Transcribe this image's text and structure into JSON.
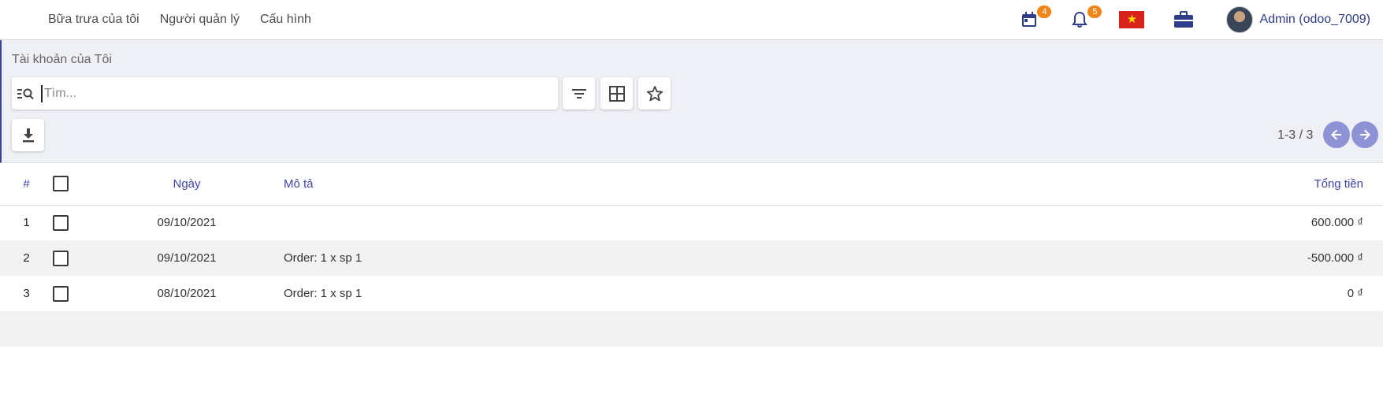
{
  "navbar": {
    "menu": [
      "Bữa trưa của tôi",
      "Người quản lý",
      "Cấu hình"
    ],
    "calendar_badge": "4",
    "notifications_badge": "5",
    "flag_icon": "vietnam-flag-icon",
    "user_name": "Admin (odoo_7009)"
  },
  "control_panel": {
    "breadcrumb": "Tài khoản của Tôi",
    "search_placeholder": "Tìm...",
    "buttons": [
      "filter-icon",
      "grid-icon",
      "star-icon",
      "download-icon"
    ],
    "pager": "1-3 / 3"
  },
  "table": {
    "headers": {
      "num": "#",
      "date": "Ngày",
      "description": "Mô tả",
      "total": "Tổng tiền"
    },
    "rows": [
      {
        "num": "1",
        "date": "09/10/2021",
        "description": "",
        "total": "600.000 ₫"
      },
      {
        "num": "2",
        "date": "09/10/2021",
        "description": "Order: 1 x sp 1",
        "total": "-500.000 ₫"
      },
      {
        "num": "3",
        "date": "08/10/2021",
        "description": "Order: 1 x sp 1",
        "total": "0 ₫"
      }
    ]
  },
  "colors": {
    "accent": "#3e44a8",
    "pager": "#8e93d6",
    "badge": "#f0861a",
    "control_bg": "#eef0f5"
  }
}
